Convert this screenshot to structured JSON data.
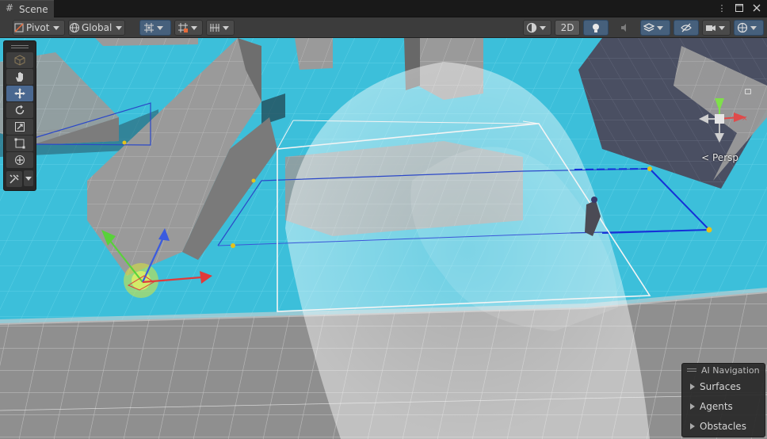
{
  "window": {
    "tab_title": "Scene",
    "tab_icon": "hash-grid-icon"
  },
  "toolbar": {
    "pivot_label": "Pivot",
    "global_label": "Global",
    "mode_2d_label": "2D"
  },
  "palette": {
    "tools": [
      "view-cube",
      "hand",
      "move",
      "rotate",
      "scale",
      "rect",
      "transform",
      "custom-tools"
    ],
    "active_tool": "move"
  },
  "gizmo": {
    "projection_label": "Persp"
  },
  "ai_navigation": {
    "title": "AI Navigation",
    "items": [
      {
        "label": "Surfaces"
      },
      {
        "label": "Agents"
      },
      {
        "label": "Obstacles"
      }
    ]
  },
  "colors": {
    "navmesh": "#3fc1dc",
    "panel_bg": "#3c3c3c",
    "selection_blue": "#4a6890",
    "axis_x": "#e03a3a",
    "axis_y": "#58d23a",
    "axis_z": "#3a5be0"
  }
}
